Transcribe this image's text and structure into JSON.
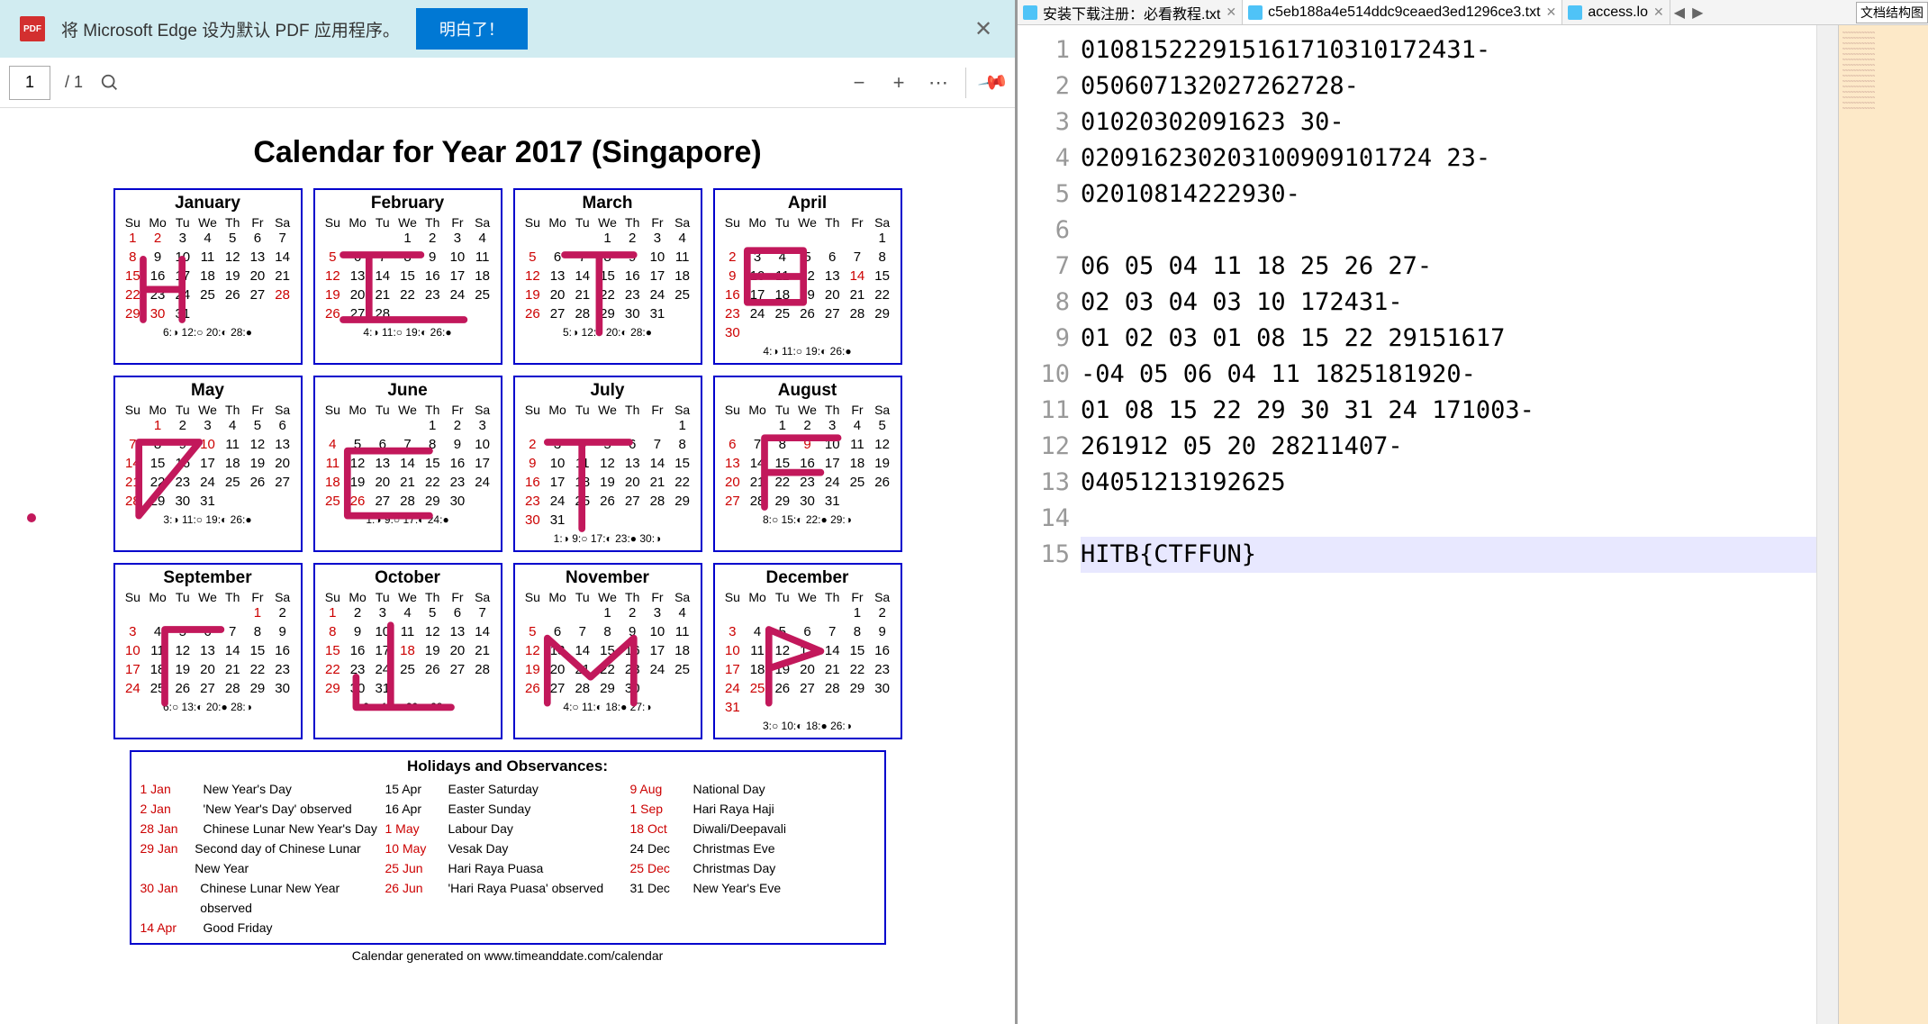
{
  "notification": {
    "text": "将 Microsoft Edge 设为默认 PDF 应用程序。",
    "button": "明白了！",
    "icon_label": "PDF"
  },
  "toolbar": {
    "page_current": "1",
    "page_total": "/ 1"
  },
  "calendar_title": "Calendar for Year 2017 (Singapore)",
  "dow": [
    "Su",
    "Mo",
    "Tu",
    "We",
    "Th",
    "Fr",
    "Sa"
  ],
  "months": [
    {
      "name": "January",
      "start": 0,
      "len": 31,
      "red": [
        1,
        2,
        8,
        15,
        22,
        28,
        29,
        30
      ],
      "moon": "6:◑ 12:○ 20:◐ 28:●"
    },
    {
      "name": "February",
      "start": 3,
      "len": 28,
      "red": [
        5,
        12,
        19,
        26
      ],
      "moon": "4:◑ 11:○ 19:◐ 26:●"
    },
    {
      "name": "March",
      "start": 3,
      "len": 31,
      "red": [
        5,
        12,
        19,
        26
      ],
      "moon": "5:◑ 12:○ 20:◐ 28:●"
    },
    {
      "name": "April",
      "start": 6,
      "len": 30,
      "red": [
        2,
        9,
        14,
        16,
        23,
        30
      ],
      "moon": "4:◑ 11:○ 19:◐ 26:●"
    },
    {
      "name": "May",
      "start": 1,
      "len": 31,
      "red": [
        1,
        7,
        10,
        14,
        21,
        28
      ],
      "moon": "3:◑ 11:○ 19:◐ 26:●"
    },
    {
      "name": "June",
      "start": 4,
      "len": 30,
      "red": [
        4,
        11,
        18,
        25,
        26
      ],
      "moon": "1:◑ 9:○ 17:◐ 24:●"
    },
    {
      "name": "July",
      "start": 6,
      "len": 31,
      "red": [
        2,
        9,
        16,
        23,
        30
      ],
      "moon": "1:◑ 9:○ 17:◐ 23:● 30:◑"
    },
    {
      "name": "August",
      "start": 2,
      "len": 31,
      "red": [
        6,
        9,
        13,
        20,
        27
      ],
      "moon": "8:○ 15:◐ 22:● 29:◑"
    },
    {
      "name": "September",
      "start": 5,
      "len": 30,
      "red": [
        1,
        3,
        10,
        17,
        24
      ],
      "moon": "6:○ 13:◐ 20:● 28:◑"
    },
    {
      "name": "October",
      "start": 0,
      "len": 31,
      "red": [
        1,
        8,
        15,
        18,
        22,
        29
      ],
      "moon": "6:○ 12:◐ 20:● 28:◑"
    },
    {
      "name": "November",
      "start": 3,
      "len": 30,
      "red": [
        5,
        12,
        19,
        26
      ],
      "moon": "4:○ 11:◐ 18:● 27:◑"
    },
    {
      "name": "December",
      "start": 5,
      "len": 31,
      "red": [
        3,
        10,
        17,
        24,
        25,
        31
      ],
      "moon": "3:○ 10:◐ 18:● 26:◑"
    }
  ],
  "scribbles": [
    "M30,80 L30,150 M30,115 L75,115 M75,80 L75,150",
    "M30,75 L120,75 M60,75 L60,150 M30,150 L170,150",
    "M95,75 L95,165 M55,75 L135,75",
    "M35,70 L100,70 L100,130 L35,130 Z M35,100 L100,100",
    "M25,75 L95,75 M25,75 L25,160 M95,75 L25,160",
    "M35,85 L130,85 M35,85 L35,160 M35,160 L130,160",
    "M35,75 L130,75 M75,75 L75,175",
    "M55,70 L140,70 M55,70 L55,150 M55,110 L120,110",
    "M55,75 L120,75 M55,75 L55,160 M55,160 L55,160",
    "M85,70 L85,165 M45,165 L155,165 M45,165 L45,130",
    "M35,85 L35,160 M35,85 L85,130 L135,85 L135,160",
    "M60,75 L60,160 M60,75 L120,100 L60,120",
    ""
  ],
  "holidays_title": "Holidays and Observances:",
  "holidays": [
    [
      {
        "d": "1 Jan",
        "t": "New Year's Day",
        "r": true
      },
      {
        "d": "2 Jan",
        "t": "'New Year's Day' observed",
        "r": true
      },
      {
        "d": "28 Jan",
        "t": "Chinese Lunar New Year's Day",
        "r": true
      },
      {
        "d": "29 Jan",
        "t": "Second day of Chinese Lunar New Year",
        "r": true
      },
      {
        "d": "30 Jan",
        "t": "Chinese Lunar New Year observed",
        "r": true
      },
      {
        "d": "14 Apr",
        "t": "Good Friday",
        "r": true
      }
    ],
    [
      {
        "d": "15 Apr",
        "t": "Easter Saturday",
        "r": false
      },
      {
        "d": "16 Apr",
        "t": "Easter Sunday",
        "r": false
      },
      {
        "d": "1 May",
        "t": "Labour Day",
        "r": true
      },
      {
        "d": "10 May",
        "t": "Vesak Day",
        "r": true
      },
      {
        "d": "25 Jun",
        "t": "Hari Raya Puasa",
        "r": true
      },
      {
        "d": "26 Jun",
        "t": "'Hari Raya Puasa' observed",
        "r": true
      }
    ],
    [
      {
        "d": "9 Aug",
        "t": "National Day",
        "r": true
      },
      {
        "d": "1 Sep",
        "t": "Hari Raya Haji",
        "r": true
      },
      {
        "d": "18 Oct",
        "t": "Diwali/Deepavali",
        "r": true
      },
      {
        "d": "24 Dec",
        "t": "Christmas Eve",
        "r": false
      },
      {
        "d": "25 Dec",
        "t": "Christmas Day",
        "r": true
      },
      {
        "d": "31 Dec",
        "t": "New Year's Eve",
        "r": false
      }
    ]
  ],
  "footer_note": "Calendar generated on www.timeanddate.com/calendar",
  "editor": {
    "tabs": [
      {
        "label": "安装下载注册：必看教程.txt",
        "active": false
      },
      {
        "label": "c5eb188a4e514ddc9ceaed3ed1296ce3.txt",
        "active": true
      },
      {
        "label": "access.lo",
        "active": false
      }
    ],
    "structure_label": "文档结构图",
    "lines": [
      "010815222915161710310172431-",
      "050607132027262728-",
      "01020302091623 30-",
      "020916230203100909101724 23-",
      "02010814222930-",
      "",
      "06 05 04 11 18 25 26 27-",
      "02 03 04 03 10 172431-",
      "01 02 03 01 08 15 22 29151617",
      "-04 05 06 04 11 1825181920-",
      "01 08 15 22 29 30 31 24 171003-",
      "261912 05 20 28211407-",
      "04051213192625",
      "",
      "HITB{CTFFUN}"
    ],
    "highlight_line": 15
  }
}
